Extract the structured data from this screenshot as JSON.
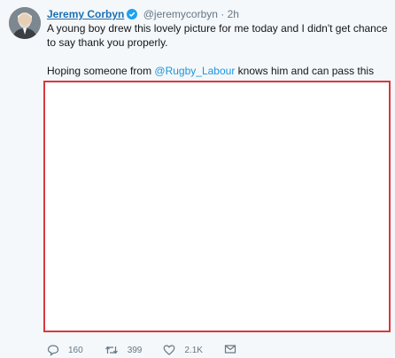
{
  "tweet": {
    "author_name": "Jeremy Corbyn",
    "handle": "@jeremycorbyn",
    "separator": "·",
    "time": "2h",
    "line1": "A young boy drew this lovely picture for me today and I didn't get chance to say thank you properly.",
    "line2_pre": "Hoping someone from ",
    "line2_mention": "@Rugby_Labour",
    "line2_post": " knows him and can pass this on.",
    "icons": {
      "verified": "verified-badge-icon",
      "reply": "reply-icon",
      "retweet": "retweet-icon",
      "like": "heart-icon",
      "dm": "envelope-icon"
    },
    "counts": {
      "replies": "160",
      "retweets": "399",
      "likes": "2.1K"
    },
    "colors": {
      "name": "#1c6fb3",
      "mention": "#1b95e0",
      "media_border": "#d9383d",
      "muted": "#657786"
    }
  }
}
